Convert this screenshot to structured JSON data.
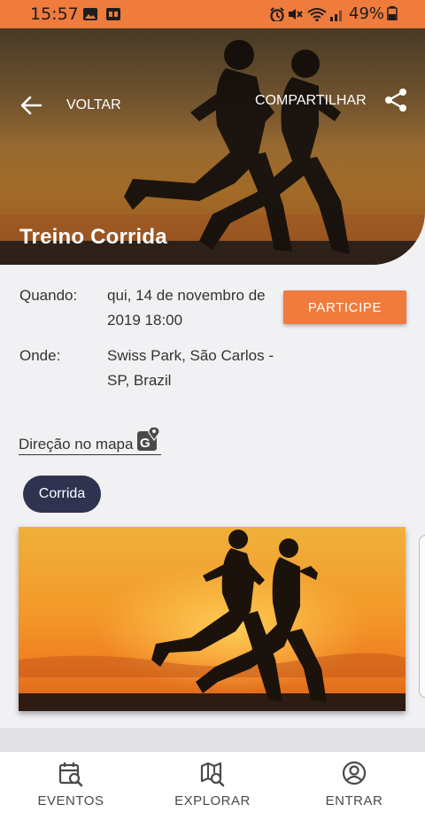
{
  "status_bar": {
    "time": "15:57",
    "battery_percent": "49%",
    "icons": [
      "image-icon",
      "app-notification-icon",
      "alarm-icon",
      "mute-icon",
      "wifi-icon",
      "signal-icon",
      "battery-icon"
    ]
  },
  "header": {
    "back_label": "VOLTAR",
    "share_label": "COMPARTILHAR",
    "title": "Treino Corrida"
  },
  "event": {
    "when_label": "Quando:",
    "when_value": "qui, 14 de novembro de 2019 18:00",
    "where_label": "Onde:",
    "where_value": "Swiss Park, São Carlos - SP, Brazil",
    "participate_label": "PARTICIPE",
    "map_link_label": "Direção no mapa",
    "tag": "Corrida"
  },
  "bottom_nav": {
    "items": [
      {
        "label": "EVENTOS",
        "icon": "calendar-search-icon"
      },
      {
        "label": "EXPLORAR",
        "icon": "map-search-icon"
      },
      {
        "label": "ENTRAR",
        "icon": "account-circle-icon"
      }
    ]
  },
  "colors": {
    "accent": "#ef7b3d",
    "chip": "#2f3350"
  }
}
